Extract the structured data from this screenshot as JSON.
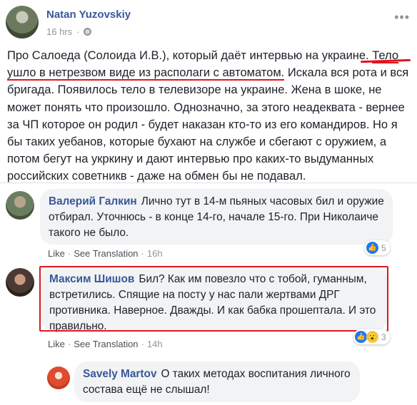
{
  "post": {
    "author": "Natan Yuzovskiy",
    "time": "16 hrs",
    "dot": "·",
    "more": "•••",
    "text_before": "Про Салоеда (Солоида И.В.), который даёт интервью на украине. ",
    "text_highlight": "Тело ушло в нетрезвом виде из располаги с автоматом.",
    "text_after": " Искала вся рота и вся бригада. Появилось тело в телевизоре на украине. Жена в шоке, не может понять что произошло. Однозначно, за этого неадеквата - вернее за ЧП которое он родил - будет наказан кто-то из его командиров. Но я бы таких уебанов, которые бухают на службе и сбегают с оружием, а потом бегут на укркину и дают интервью про каких-то выдуманных российских советникв - даже на обмен бы не подавал."
  },
  "comments": [
    {
      "name": "Валерий Галкин",
      "text": "Лично тут в 14-м пьяных часовых бил и оружие отбирал. Уточнюсь - в конце 14-го, начале 15-го. При Николаиче такого не было.",
      "like": "Like",
      "sep": "·",
      "translate": "See Translation",
      "time": "16h",
      "reactions": "5"
    },
    {
      "name": "Максим Шишов",
      "text": "Бил? Как им повезло что с тобой, гуманным, встретились. Спящие на посту у нас пали жертвами ДРГ противника. Наверное. Дважды. И как бабка прошептала. И это правильно.",
      "like": "Like",
      "sep": "·",
      "translate": "See Translation",
      "time": "14h",
      "reactions": "3"
    },
    {
      "name": "Savely Martov",
      "text": "О таких методах воспитания личного состава ещё не слышал!"
    }
  ],
  "icons": {
    "like": "👍",
    "wow": "😮"
  },
  "colors": {
    "link": "#365899",
    "highlight": "#e0151d",
    "like": "#2078f4"
  }
}
